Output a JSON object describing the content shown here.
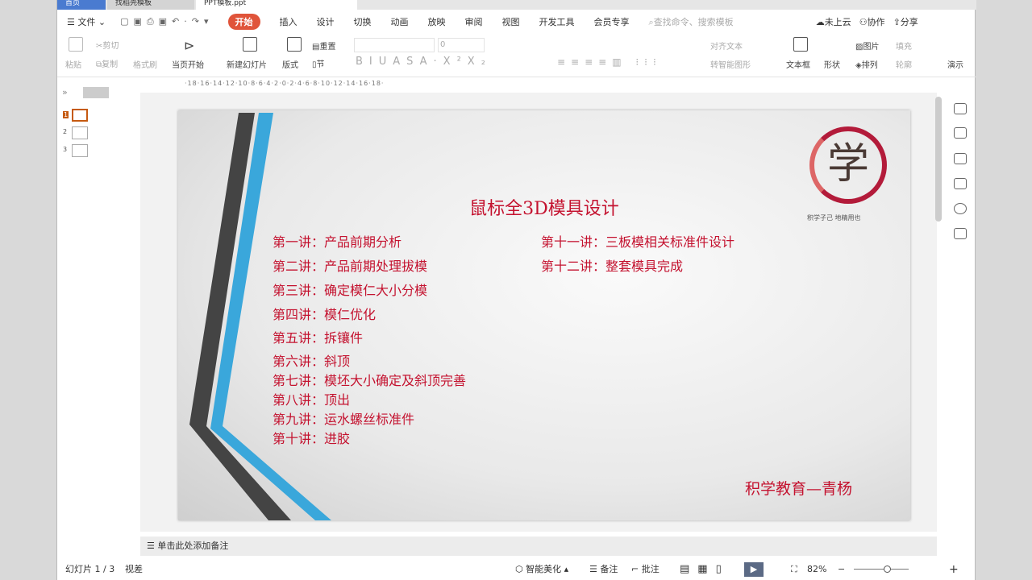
{
  "tabs": [
    "首页",
    "找稻壳模板",
    "PPT模板.ppt"
  ],
  "menu": {
    "file": "文件",
    "items": [
      "开始",
      "插入",
      "设计",
      "切换",
      "动画",
      "放映",
      "审阅",
      "视图",
      "开发工具",
      "会员专享"
    ],
    "search": "查找命令、搜索模板",
    "cloud": "未上云",
    "collab": "协作",
    "share": "分享"
  },
  "ribbon": {
    "paste": "粘贴",
    "cut": "剪切",
    "copy": "复制",
    "format_painter": "格式刷",
    "play_current": "当页开始",
    "new_slide": "新建幻灯片",
    "layout": "版式",
    "reset": "重置",
    "section": "节",
    "font_size": "0",
    "align_text": "对齐文本",
    "smart_shape": "转智能图形",
    "textbox": "文本框",
    "shape": "形状",
    "picture": "图片",
    "arrange": "排列",
    "fill": "填充",
    "outline": "轮廓",
    "present": "演示"
  },
  "ruler": "·18·16·14·12·10·8·6·4·2·0·2·4·6·8·10·12·14·16·18·",
  "thumbs": [
    "1",
    "2",
    "3"
  ],
  "slide": {
    "title": "鼠标全3D模具设计",
    "lectures_left": [
      "第一讲：产品前期分析",
      "第二讲：产品前期处理拔模",
      "第三讲：确定模仁大小分模",
      "第四讲：模仁优化",
      "第五讲：拆镶件",
      "第六讲：斜顶",
      "第七讲：模坯大小确定及斜顶完善",
      "第八讲：顶出",
      "第九讲：运水螺丝标准件",
      "第十讲：进胶"
    ],
    "lectures_right": [
      "第十一讲：三板模相关标准件设计",
      "第十二讲：整套模具完成"
    ],
    "logo_char": "学",
    "logo_caption": "积学子己  地精用也",
    "footer": "积学教育—青杨"
  },
  "notes": "单击此处添加备注",
  "status": {
    "slide_count": "幻灯片 1 / 3",
    "theme": "视差",
    "beautify": "智能美化",
    "notes": "备注",
    "comment": "批注",
    "zoom": "82%",
    "zoom_fraction": 0.6
  },
  "colors": {
    "accent": "#e0543a",
    "slide_red": "#c4122f",
    "stripe_blue": "#3aa7db"
  }
}
